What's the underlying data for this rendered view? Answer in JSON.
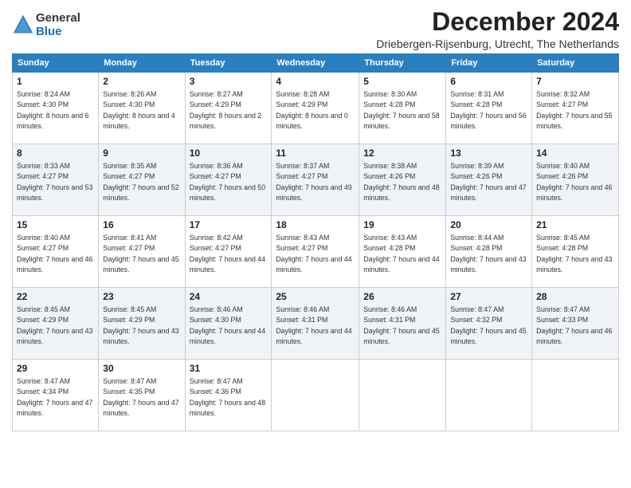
{
  "logo": {
    "general": "General",
    "blue": "Blue"
  },
  "title": "December 2024",
  "subtitle": "Driebergen-Rijsenburg, Utrecht, The Netherlands",
  "weekdays": [
    "Sunday",
    "Monday",
    "Tuesday",
    "Wednesday",
    "Thursday",
    "Friday",
    "Saturday"
  ],
  "weeks": [
    [
      {
        "day": "1",
        "sunrise": "8:24 AM",
        "sunset": "4:30 PM",
        "daylight": "8 hours and 6 minutes."
      },
      {
        "day": "2",
        "sunrise": "8:26 AM",
        "sunset": "4:30 PM",
        "daylight": "8 hours and 4 minutes."
      },
      {
        "day": "3",
        "sunrise": "8:27 AM",
        "sunset": "4:29 PM",
        "daylight": "8 hours and 2 minutes."
      },
      {
        "day": "4",
        "sunrise": "8:28 AM",
        "sunset": "4:29 PM",
        "daylight": "8 hours and 0 minutes."
      },
      {
        "day": "5",
        "sunrise": "8:30 AM",
        "sunset": "4:28 PM",
        "daylight": "7 hours and 58 minutes."
      },
      {
        "day": "6",
        "sunrise": "8:31 AM",
        "sunset": "4:28 PM",
        "daylight": "7 hours and 56 minutes."
      },
      {
        "day": "7",
        "sunrise": "8:32 AM",
        "sunset": "4:27 PM",
        "daylight": "7 hours and 55 minutes."
      }
    ],
    [
      {
        "day": "8",
        "sunrise": "8:33 AM",
        "sunset": "4:27 PM",
        "daylight": "7 hours and 53 minutes."
      },
      {
        "day": "9",
        "sunrise": "8:35 AM",
        "sunset": "4:27 PM",
        "daylight": "7 hours and 52 minutes."
      },
      {
        "day": "10",
        "sunrise": "8:36 AM",
        "sunset": "4:27 PM",
        "daylight": "7 hours and 50 minutes."
      },
      {
        "day": "11",
        "sunrise": "8:37 AM",
        "sunset": "4:27 PM",
        "daylight": "7 hours and 49 minutes."
      },
      {
        "day": "12",
        "sunrise": "8:38 AM",
        "sunset": "4:26 PM",
        "daylight": "7 hours and 48 minutes."
      },
      {
        "day": "13",
        "sunrise": "8:39 AM",
        "sunset": "4:26 PM",
        "daylight": "7 hours and 47 minutes."
      },
      {
        "day": "14",
        "sunrise": "8:40 AM",
        "sunset": "4:26 PM",
        "daylight": "7 hours and 46 minutes."
      }
    ],
    [
      {
        "day": "15",
        "sunrise": "8:40 AM",
        "sunset": "4:27 PM",
        "daylight": "7 hours and 46 minutes."
      },
      {
        "day": "16",
        "sunrise": "8:41 AM",
        "sunset": "4:27 PM",
        "daylight": "7 hours and 45 minutes."
      },
      {
        "day": "17",
        "sunrise": "8:42 AM",
        "sunset": "4:27 PM",
        "daylight": "7 hours and 44 minutes."
      },
      {
        "day": "18",
        "sunrise": "8:43 AM",
        "sunset": "4:27 PM",
        "daylight": "7 hours and 44 minutes."
      },
      {
        "day": "19",
        "sunrise": "8:43 AM",
        "sunset": "4:28 PM",
        "daylight": "7 hours and 44 minutes."
      },
      {
        "day": "20",
        "sunrise": "8:44 AM",
        "sunset": "4:28 PM",
        "daylight": "7 hours and 43 minutes."
      },
      {
        "day": "21",
        "sunrise": "8:45 AM",
        "sunset": "4:28 PM",
        "daylight": "7 hours and 43 minutes."
      }
    ],
    [
      {
        "day": "22",
        "sunrise": "8:45 AM",
        "sunset": "4:29 PM",
        "daylight": "7 hours and 43 minutes."
      },
      {
        "day": "23",
        "sunrise": "8:45 AM",
        "sunset": "4:29 PM",
        "daylight": "7 hours and 43 minutes."
      },
      {
        "day": "24",
        "sunrise": "8:46 AM",
        "sunset": "4:30 PM",
        "daylight": "7 hours and 44 minutes."
      },
      {
        "day": "25",
        "sunrise": "8:46 AM",
        "sunset": "4:31 PM",
        "daylight": "7 hours and 44 minutes."
      },
      {
        "day": "26",
        "sunrise": "8:46 AM",
        "sunset": "4:31 PM",
        "daylight": "7 hours and 45 minutes."
      },
      {
        "day": "27",
        "sunrise": "8:47 AM",
        "sunset": "4:32 PM",
        "daylight": "7 hours and 45 minutes."
      },
      {
        "day": "28",
        "sunrise": "8:47 AM",
        "sunset": "4:33 PM",
        "daylight": "7 hours and 46 minutes."
      }
    ],
    [
      {
        "day": "29",
        "sunrise": "8:47 AM",
        "sunset": "4:34 PM",
        "daylight": "7 hours and 47 minutes."
      },
      {
        "day": "30",
        "sunrise": "8:47 AM",
        "sunset": "4:35 PM",
        "daylight": "7 hours and 47 minutes."
      },
      {
        "day": "31",
        "sunrise": "8:47 AM",
        "sunset": "4:36 PM",
        "daylight": "7 hours and 48 minutes."
      },
      null,
      null,
      null,
      null
    ]
  ]
}
